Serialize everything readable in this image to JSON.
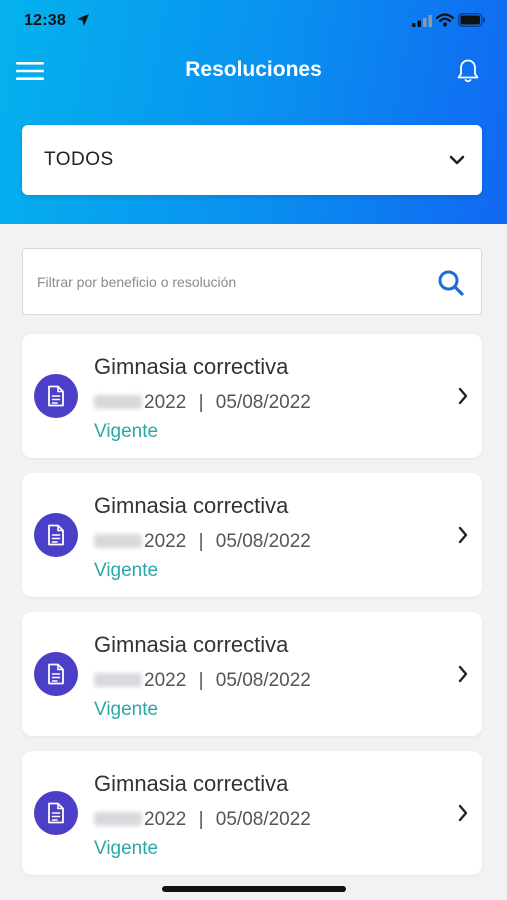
{
  "status_bar": {
    "time": "12:38"
  },
  "header": {
    "title": "Resoluciones"
  },
  "filter": {
    "selected": "TODOS"
  },
  "search": {
    "placeholder": "Filtrar por beneficio o resolución"
  },
  "cards": [
    {
      "title": "Gimnasia correctiva",
      "year": "2022",
      "separator": "|",
      "date": "05/08/2022",
      "status": "Vigente"
    },
    {
      "title": "Gimnasia correctiva",
      "year": "2022",
      "separator": "|",
      "date": "05/08/2022",
      "status": "Vigente"
    },
    {
      "title": "Gimnasia correctiva",
      "year": "2022",
      "separator": "|",
      "date": "05/08/2022",
      "status": "Vigente"
    },
    {
      "title": "Gimnasia correctiva",
      "year": "2022",
      "separator": "|",
      "date": "05/08/2022",
      "status": "Vigente"
    }
  ],
  "colors": {
    "header_gradient_start": "#04b2ee",
    "header_gradient_end": "#1167f2",
    "icon_circle": "#4c3fc7",
    "status_green": "#2aa8a6"
  },
  "icons": [
    "location-arrow-icon",
    "signal-icon",
    "wifi-icon",
    "battery-icon",
    "menu-icon",
    "bell-icon",
    "chevron-down-icon",
    "search-icon",
    "document-icon",
    "chevron-right-icon"
  ]
}
